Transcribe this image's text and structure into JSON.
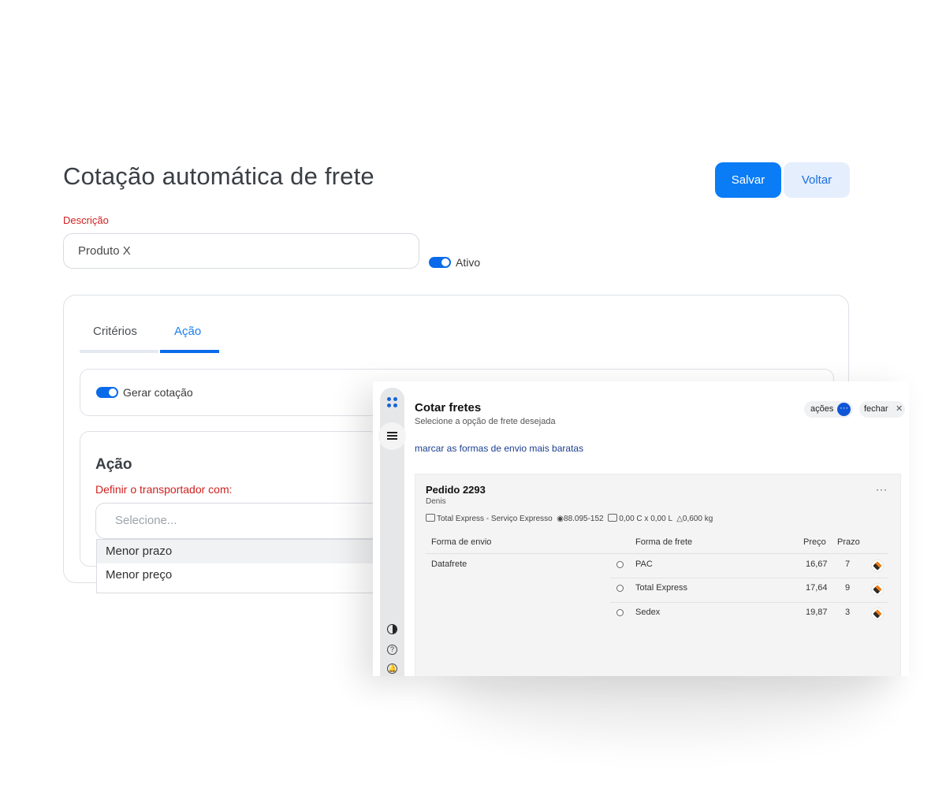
{
  "page": {
    "title": "Cotação automática de frete",
    "save_label": "Salvar",
    "back_label": "Voltar"
  },
  "form": {
    "description_label": "Descrição",
    "description_value": "Produto X",
    "active_label": "Ativo",
    "active_on": true
  },
  "tabs": [
    {
      "label": "Critérios",
      "active": false
    },
    {
      "label": "Ação",
      "active": true
    }
  ],
  "action_panel": {
    "generate_label": "Gerar cotação",
    "generate_on": true,
    "heading": "Ação",
    "carrier_label": "Definir o transportador com:",
    "select_placeholder": "Selecione...",
    "options": [
      "Menor prazo",
      "Menor preço"
    ]
  },
  "overlay": {
    "title": "Cotar fretes",
    "subtitle": "Selecione a opção de frete desejada",
    "cheapest_link": "marcar as formas de envio mais baratas",
    "actions_label": "ações",
    "close_label": "fechar",
    "order": {
      "title": "Pedido 2293",
      "client": "Denis",
      "carrier_service": "Total Express - Serviço Expresso",
      "zip": "88.095-152",
      "dimensions": "0,00 C x 0,00 L",
      "weight": "0,600 kg",
      "headers": {
        "shipping_method": "Forma de envio",
        "freight_method": "Forma de frete",
        "price": "Preço",
        "term": "Prazo"
      },
      "shipping_method": "Datafrete",
      "rows": [
        {
          "freight": "PAC",
          "price": "16,67",
          "term": "7"
        },
        {
          "freight": "Total Express",
          "price": "17,64",
          "term": "9"
        },
        {
          "freight": "Sedex",
          "price": "19,87",
          "term": "3"
        }
      ]
    }
  },
  "icons": {
    "apps": "apps-grid-icon",
    "menu": "hamburger-menu-icon",
    "contrast": "contrast-icon",
    "help": "help-circle-icon",
    "notifications": "bell-icon",
    "carrier_logo": "carrier-logo-icon"
  },
  "colors": {
    "primary": "#0a7cf5",
    "secondary_button_bg": "#e5eefc",
    "required_label": "#d11f1f",
    "link": "#1c3f8f",
    "carrier_orange": "#f07b1a"
  }
}
